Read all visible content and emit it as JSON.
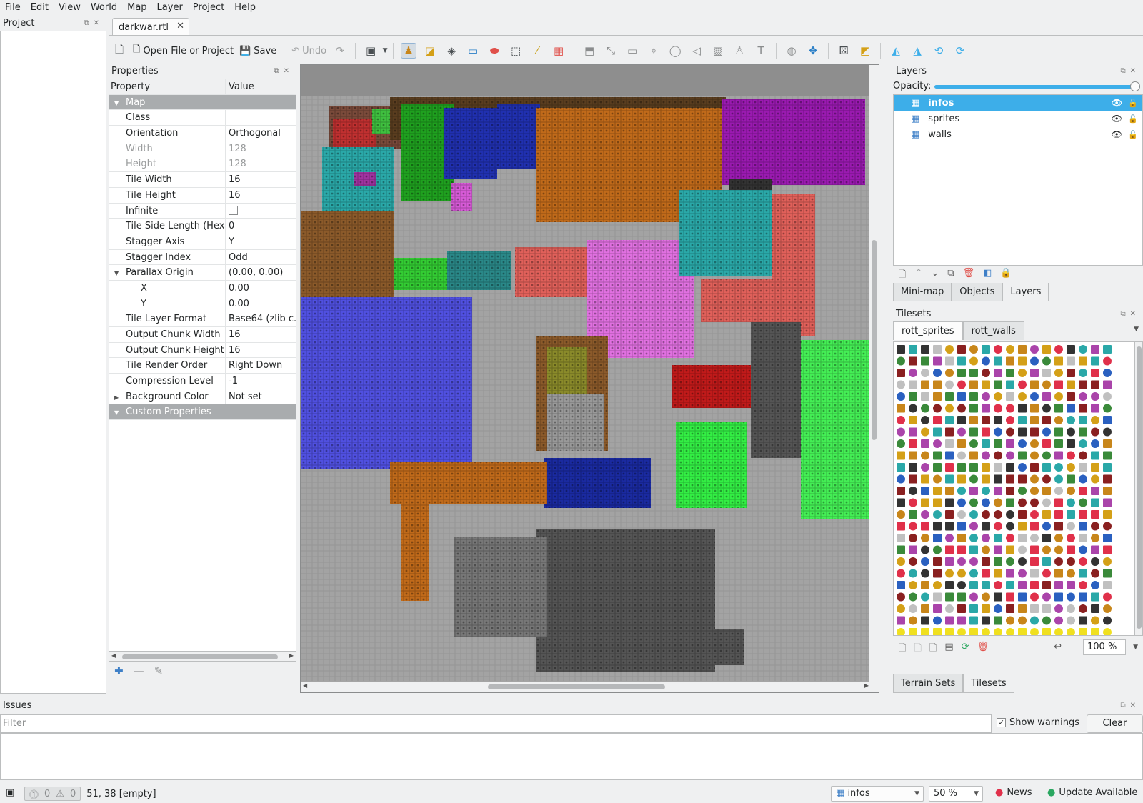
{
  "menu": [
    "File",
    "Edit",
    "View",
    "World",
    "Map",
    "Layer",
    "Project",
    "Help"
  ],
  "project_dock": {
    "title": "Project"
  },
  "document_tab": {
    "label": "darkwar.rtl"
  },
  "toolbar": {
    "open_label": "Open File or Project",
    "save_label": "Save",
    "undo_label": "Undo"
  },
  "properties": {
    "title": "Properties",
    "header": {
      "property": "Property",
      "value": "Value"
    },
    "rows": [
      {
        "k": "Map",
        "v": "",
        "type": "group"
      },
      {
        "k": "Class",
        "v": ""
      },
      {
        "k": "Orientation",
        "v": "Orthogonal"
      },
      {
        "k": "Width",
        "v": "128",
        "type": "dim"
      },
      {
        "k": "Height",
        "v": "128",
        "type": "dim"
      },
      {
        "k": "Tile Width",
        "v": "16"
      },
      {
        "k": "Tile Height",
        "v": "16"
      },
      {
        "k": "Infinite",
        "v": "",
        "type": "check"
      },
      {
        "k": "Tile Side Length (Hex)",
        "v": "0"
      },
      {
        "k": "Stagger Axis",
        "v": "Y"
      },
      {
        "k": "Stagger Index",
        "v": "Odd"
      },
      {
        "k": "Parallax Origin",
        "v": "(0.00, 0.00)",
        "type": "expand-open"
      },
      {
        "k": "X",
        "v": "0.00",
        "type": "sub"
      },
      {
        "k": "Y",
        "v": "0.00",
        "type": "sub"
      },
      {
        "k": "Tile Layer Format",
        "v": "Base64 (zlib c..."
      },
      {
        "k": "Output Chunk Width",
        "v": "16"
      },
      {
        "k": "Output Chunk Height",
        "v": "16"
      },
      {
        "k": "Tile Render Order",
        "v": "Right Down"
      },
      {
        "k": "Compression Level",
        "v": "-1"
      },
      {
        "k": "Background Color",
        "v": "Not set",
        "type": "expand-closed"
      },
      {
        "k": "Custom Properties",
        "v": "",
        "type": "group"
      }
    ]
  },
  "layers": {
    "title": "Layers",
    "opacity_label": "Opacity:",
    "opacity": 1.0,
    "items": [
      {
        "name": "infos",
        "selected": true
      },
      {
        "name": "sprites",
        "selected": false
      },
      {
        "name": "walls",
        "selected": false
      }
    ],
    "tabs": [
      "Mini-map",
      "Objects",
      "Layers"
    ]
  },
  "tilesets": {
    "title": "Tilesets",
    "tabs": [
      "rott_sprites",
      "rott_walls"
    ],
    "zoom": "100 %",
    "bottom_tabs": [
      "Terrain Sets",
      "Tilesets"
    ]
  },
  "issues": {
    "title": "Issues",
    "filter_placeholder": "Filter",
    "show_warnings": "Show warnings",
    "clear": "Clear"
  },
  "statusbar": {
    "errors": "0",
    "warnings": "0",
    "position": "51, 38 [empty]",
    "layer": "infos",
    "zoom": "50 %",
    "news": "News",
    "update": "Update Available"
  },
  "colors": {
    "selection": "#3daee9",
    "group_row": "#a9acae"
  }
}
